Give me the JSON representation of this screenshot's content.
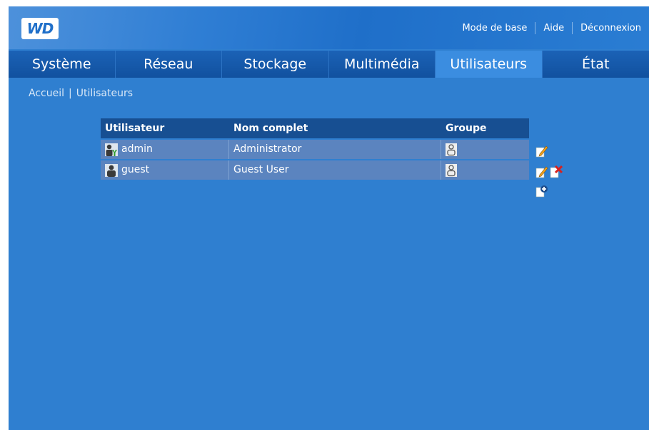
{
  "header": {
    "logo_text": "WD",
    "links": [
      "Mode de base",
      "Aide",
      "Déconnexion"
    ]
  },
  "nav": {
    "tabs": [
      "Système",
      "Réseau",
      "Stockage",
      "Multimédia",
      "Utilisateurs",
      "État"
    ],
    "active": "Utilisateurs"
  },
  "breadcrumb": {
    "home": "Accueil",
    "current": "Utilisateurs"
  },
  "table": {
    "headers": [
      "Utilisateur",
      "Nom complet",
      "Groupe"
    ],
    "rows": [
      {
        "user": "admin",
        "full_name": "Administrator",
        "user_icon": "admin-user-icon",
        "group_icon": "group-icon"
      },
      {
        "user": "guest",
        "full_name": "Guest User",
        "user_icon": "user-icon",
        "group_icon": "group-icon"
      }
    ]
  },
  "icons": {
    "edit": "edit-icon",
    "delete": "delete-icon",
    "add_user": "add-user-icon"
  },
  "colors": {
    "background": "#2f7fd0",
    "nav": "#11519f",
    "active_tab": "#3b8de0",
    "table_header": "#174f92",
    "table_row": "#5b84bf"
  }
}
